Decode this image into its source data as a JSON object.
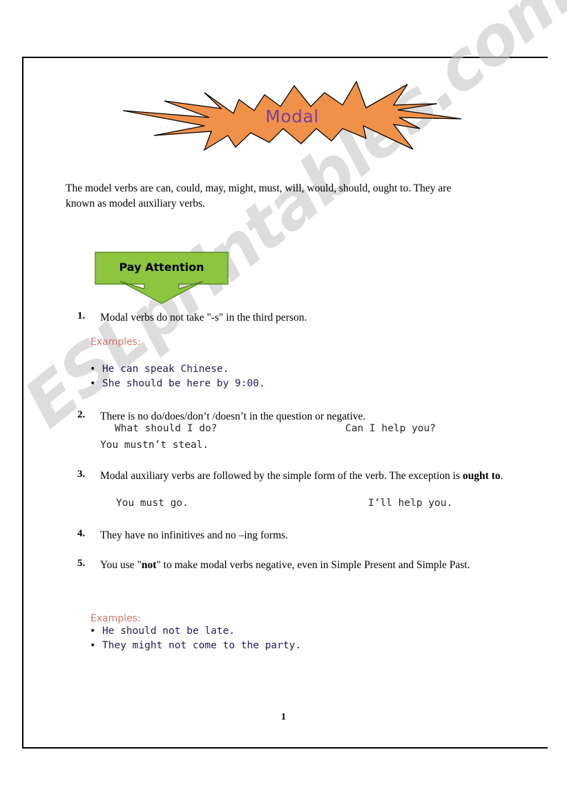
{
  "document": {
    "page_number": "1",
    "watermark": "ESLprintables.com"
  },
  "title_banner": {
    "shape": "starburst-shape",
    "fill_color": "#F0914A",
    "outline_color": "#000000",
    "title": "Modal",
    "title_color": "#7A3F9D",
    "subtitle_dots": ". ... ."
  },
  "intro": {
    "text": "The model verbs are can, could, may, might, must, will, would, should, ought to. They are known as model auxiliary verbs."
  },
  "pay_attention": {
    "label": "Pay Attention",
    "fill_color": "#8CC63F",
    "outline_color": "#4B7A1E"
  },
  "examples_heading": {
    "label": "Examples:",
    "color": "#D4776A"
  },
  "rules": [
    {
      "number": "1.",
      "text_before": "Modal verbs do not take \"-s\" in the third person.",
      "bold": "",
      "text_after": ""
    },
    {
      "number": "2.",
      "text_before": "There is no do/does/don’t /doesn’t in the question or negative.",
      "bold": "",
      "text_after": ""
    },
    {
      "number": "3.",
      "text_before": "Modal auxiliary verbs are followed by the simple form of the verb. The exception is ",
      "bold": "ought to",
      "text_after": "."
    },
    {
      "number": "4.",
      "text_before": "They have no infinitives and no –ing forms.",
      "bold": "",
      "text_after": ""
    },
    {
      "number": "5.",
      "text_before": "You use \"",
      "bold": "not",
      "text_after": "\" to make modal verbs negative, even in Simple Present and Simple Past."
    }
  ],
  "examples_group_1": {
    "bullet_char": "•",
    "items": [
      "He can speak Chinese.",
      "She should be here by 9:00."
    ]
  },
  "examples_group_2": {
    "bullet_char": "•",
    "items": [
      "He should not be late.",
      "They might not come to the party."
    ]
  },
  "inline_examples": {
    "rule2_left": "What should I do?",
    "rule2_right": "Can I help you?",
    "rule2_second_line": "You mustn’t steal.",
    "rule3_left": "You must go.",
    "rule3_right": "I’ll help you."
  }
}
